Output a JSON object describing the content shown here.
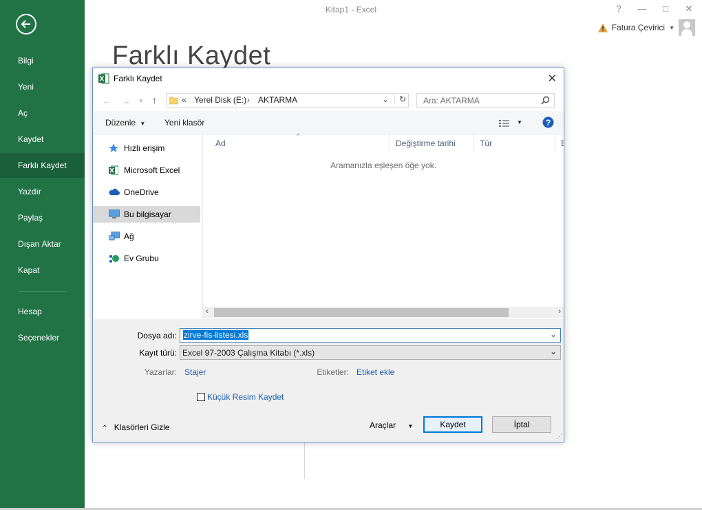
{
  "app": {
    "window_title": "Kitap1 - Excel",
    "window_controls": [
      "?",
      "—",
      "□",
      "✕"
    ],
    "account_name": "Fatura Çevirici",
    "page_heading": "Farklı Kaydet"
  },
  "sidebar": {
    "items": [
      {
        "label": "Bilgi"
      },
      {
        "label": "Yeni"
      },
      {
        "label": "Aç"
      },
      {
        "label": "Kaydet"
      },
      {
        "label": "Farklı Kaydet",
        "active": true
      },
      {
        "label": "Yazdır"
      },
      {
        "label": "Paylaş"
      },
      {
        "label": "Dışarı Aktar"
      },
      {
        "label": "Kapat"
      },
      {
        "label": "Hesap"
      },
      {
        "label": "Seçenekler"
      }
    ]
  },
  "dialog": {
    "title": "Farklı Kaydet",
    "breadcrumb": {
      "overflow": "«",
      "drive": "Yerel Disk (E:)",
      "folder": "AKTARMA"
    },
    "search_placeholder": "Ara: AKTARMA",
    "toolbar": {
      "organize": "Düzenle",
      "new_folder": "Yeni klasör"
    },
    "nav_items": [
      {
        "label": "Hızlı erişim",
        "icon": "star-icon"
      },
      {
        "label": "Microsoft Excel",
        "icon": "excel-icon"
      },
      {
        "label": "OneDrive",
        "icon": "cloud-icon"
      },
      {
        "label": "Bu bilgisayar",
        "icon": "computer-icon",
        "selected": true
      },
      {
        "label": "Ağ",
        "icon": "network-icon"
      },
      {
        "label": "Ev Grubu",
        "icon": "homegroup-icon"
      }
    ],
    "columns": [
      "Ad",
      "Değiştirme tarihi",
      "Tür",
      "B"
    ],
    "empty_message": "Aramanızla eşleşen öğe yok.",
    "form": {
      "filename_label": "Dosya adı:",
      "filename_value": "zirve-fis-listesi.xls",
      "filetype_label": "Kayıt türü:",
      "filetype_value": "Excel 97-2003 Çalışma Kitabı (*.xls)",
      "authors_label": "Yazarlar:",
      "authors_value": "Stajer",
      "tags_label": "Etiketler:",
      "tags_value": "Etiket ekle",
      "thumbnail_label": "Küçük Resim Kaydet"
    },
    "footer": {
      "hide_folders": "Klasörleri Gizle",
      "tools": "Araçlar",
      "save": "Kaydet",
      "cancel": "İptal"
    }
  },
  "colors": {
    "excel_green": "#217346",
    "excel_green_active": "#19603a",
    "accent_blue": "#0078d7"
  }
}
